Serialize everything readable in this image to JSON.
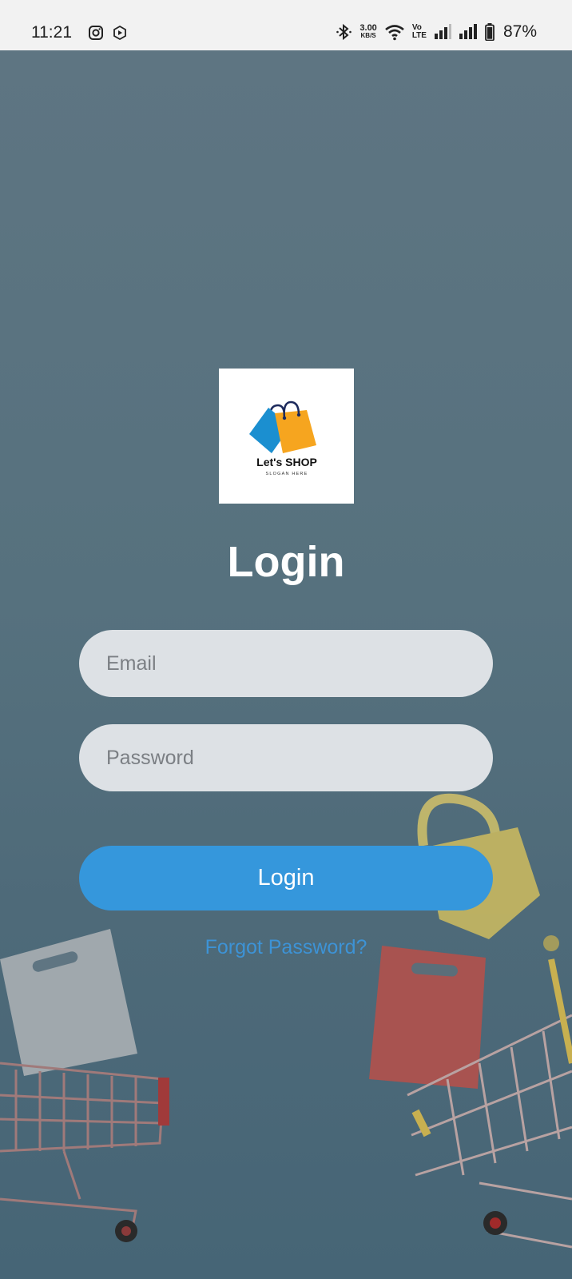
{
  "status_bar": {
    "time": "11:21",
    "speed_value": "3.00",
    "speed_unit": "KB/S",
    "volte_top": "Vo",
    "volte_bottom": "LTE",
    "battery": "87%",
    "icons": [
      "instagram-icon",
      "media-play-icon",
      "bluetooth-icon",
      "wifi-icon",
      "volte-icon",
      "signal-icon",
      "signal-icon",
      "battery-icon"
    ]
  },
  "logo": {
    "brand": "Let's SHOP",
    "slogan": "SLOGAN HERE",
    "colors": {
      "blue_bag": "#1b8fd0",
      "orange_bag": "#f6a51f",
      "handle": "#1d2a5c"
    }
  },
  "login": {
    "title": "Login",
    "email_placeholder": "Email",
    "password_placeholder": "Password",
    "button_label": "Login",
    "forgot_label": "Forgot Password?"
  },
  "colors": {
    "background": "#567080",
    "field": "#dde1e5",
    "button": "#3597dc",
    "link": "#3d93d6"
  }
}
